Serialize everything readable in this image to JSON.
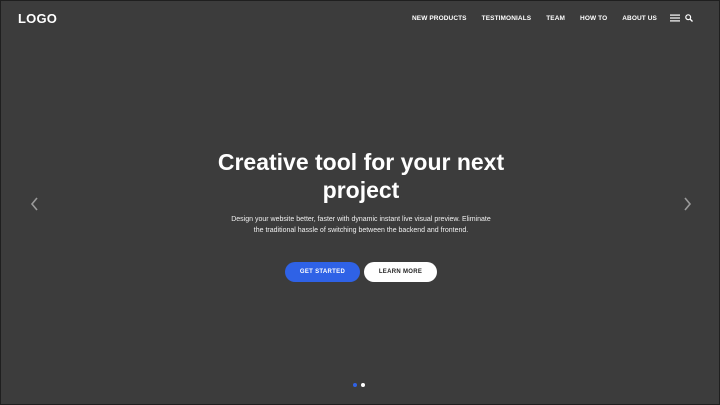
{
  "header": {
    "logo": "LOGO",
    "nav": [
      {
        "label": "NEW PRODUCTS"
      },
      {
        "label": "TESTIMONIALS"
      },
      {
        "label": "TEAM"
      },
      {
        "label": "HOW TO"
      },
      {
        "label": "ABOUT US"
      }
    ],
    "icons": [
      "menu-icon",
      "search-icon"
    ]
  },
  "hero": {
    "title": "Creative tool for your next project",
    "subtitle": "Design your website better, faster with dynamic instant live visual preview. Eliminate the traditional hassle of switching between the backend and frontend.",
    "primary_button": "GET STARTED",
    "secondary_button": "LEARN MORE",
    "prev_icon": "chevron-left-icon",
    "next_icon": "chevron-right-icon"
  },
  "slider": {
    "total_slides": 2,
    "active_slide": 1
  },
  "colors": {
    "background": "#3c3c3c",
    "accent": "#2f62e6",
    "text": "#ffffff",
    "dot_inactive": "#ffffff"
  }
}
